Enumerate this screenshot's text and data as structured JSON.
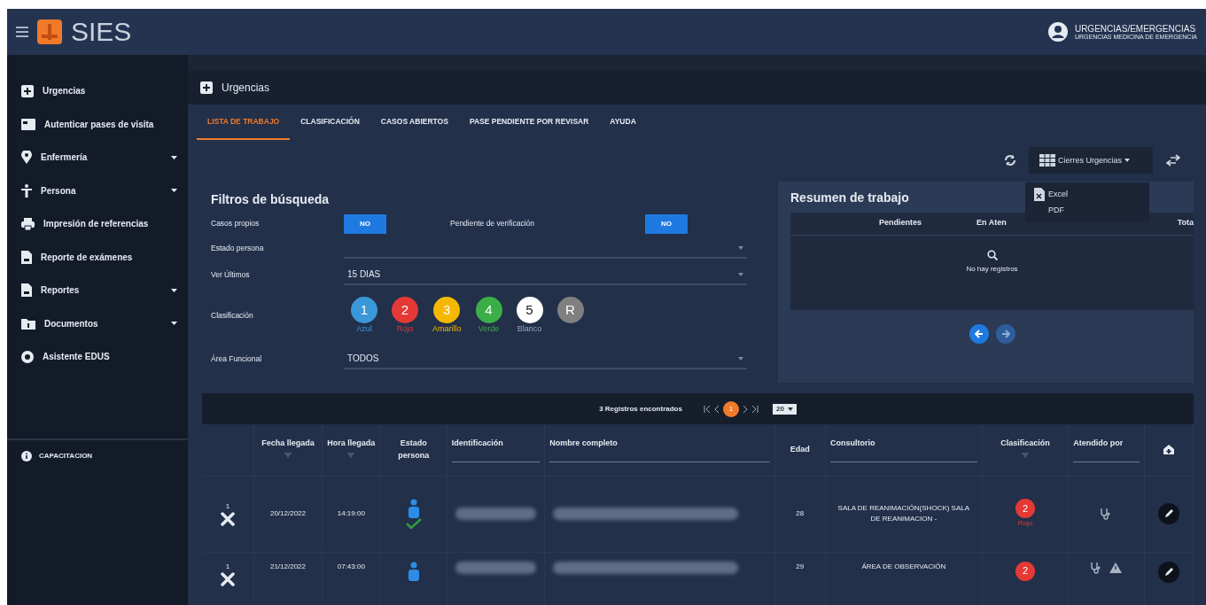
{
  "header": {
    "app_name": "SIES",
    "user_title": "URGENCIAS/EMERGENCIAS",
    "user_subtitle": "URGENCIAS MEDICINA DE EMERGENCIA"
  },
  "sidebar": {
    "items": [
      {
        "label": "Urgencias",
        "kind": "plus",
        "expandable": false
      },
      {
        "label": "Autenticar pases de visita",
        "kind": "card",
        "expandable": false
      },
      {
        "label": "Enfermería",
        "kind": "pin",
        "expandable": true
      },
      {
        "label": "Persona",
        "kind": "person",
        "expandable": true
      },
      {
        "label": "Impresión de referencias",
        "kind": "printer",
        "expandable": false
      },
      {
        "label": "Reporte de exámenes",
        "kind": "doc",
        "expandable": false
      },
      {
        "label": "Reportes",
        "kind": "doc",
        "expandable": true
      },
      {
        "label": "Documentos",
        "kind": "folder",
        "expandable": true
      },
      {
        "label": "Asistente EDUS",
        "kind": "gear",
        "expandable": false
      }
    ],
    "footer": "CAPACITACION"
  },
  "breadcrumb": "Urgencias",
  "tabs": [
    {
      "label": "LISTA DE TRABAJO",
      "selected": true
    },
    {
      "label": "CLASIFICACIÓN",
      "selected": false
    },
    {
      "label": "CASOS ABIERTOS",
      "selected": false
    },
    {
      "label": "PASE PENDIENTE POR REVISAR",
      "selected": false
    },
    {
      "label": "AYUDA",
      "selected": false
    }
  ],
  "toolbar": {
    "closing_dropdown": "Cierres Urgencias",
    "menu": [
      {
        "label": "Excel",
        "kind": "excel"
      },
      {
        "label": "PDF",
        "kind": "pdf"
      }
    ]
  },
  "filters": {
    "title": "Filtros de búsqueda",
    "own_cases": {
      "label": "Casos propios",
      "value": "NO"
    },
    "pending": {
      "label": "Pendiente de verificación",
      "value": "NO"
    },
    "person_state": {
      "label": "Estado persona"
    },
    "last": {
      "label": "Ver Últimos",
      "value": "15 DIAS"
    },
    "classification": {
      "label": "Clasificación",
      "levels": [
        {
          "number": "1",
          "name": "Azul",
          "color": "#3a97d9"
        },
        {
          "number": "2",
          "name": "Rojo",
          "color": "#e53935"
        },
        {
          "number": "3",
          "name": "Amarillo",
          "color": "#f5b800"
        },
        {
          "number": "4",
          "name": "Verde",
          "color": "#3cae48"
        },
        {
          "number": "5",
          "name": "Blanco",
          "color": "#ffffff"
        },
        {
          "number": "R",
          "color": "#808080"
        }
      ]
    },
    "area": {
      "label": "Área Funcional",
      "value": "TODOS"
    }
  },
  "summary": {
    "title": "Resumen de trabajo",
    "columns": [
      "Pendientes",
      "En Aten",
      "Tota"
    ],
    "empty": "No hay registros"
  },
  "table": {
    "count": "3 Registros encontrados",
    "current_page": "1",
    "page_size": "20",
    "columns": [
      {
        "label": "Fecha llegada",
        "sortable": true
      },
      {
        "label": "Hora llegada",
        "sortable": true
      },
      {
        "label": "Estado persona",
        "sortable": false
      },
      {
        "label": "Identificación",
        "filter": true
      },
      {
        "label": "Nombre completo",
        "filter": true
      },
      {
        "label": "Edad"
      },
      {
        "label": "Consultorio",
        "filter": true
      },
      {
        "label": "Clasificación",
        "sortable": true
      },
      {
        "label": "Atendido por",
        "filter": true
      }
    ],
    "rows": [
      {
        "order": "1",
        "date": "20/12/2022",
        "time": "14:19:00",
        "verified": true,
        "age": "28",
        "room": "SALA DE REANIMACIÓN(SHOCK) SALA DE REANIMACION -",
        "class_number": "2",
        "class_name": "Rojo",
        "color": "#e53935",
        "warning": false
      },
      {
        "order": "1",
        "date": "21/12/2022",
        "time": "07:43:00",
        "verified": false,
        "age": "29",
        "room": "ÁREA DE OBSERVACIÓN",
        "class_number": "2",
        "color": "#e53935",
        "warning": true
      }
    ]
  }
}
